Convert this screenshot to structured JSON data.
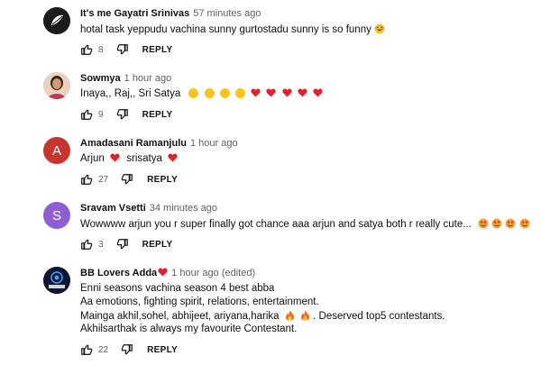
{
  "colors": {
    "heart": "#e5202e",
    "emoji_yellow": "#f7c51e",
    "emoji_face_red": "#f2a43a",
    "avatar_red": "#c6362f",
    "avatar_purple": "#8e5fd2",
    "secondary_text": "#606060"
  },
  "comments": [
    {
      "author": "It's me Gayatri Srinivas",
      "time": "57 minutes ago",
      "text": "hotal task yeppudu vachina sunny gurtostadu sunny is so funny",
      "emoji": "rofl-emoji",
      "likes": "8",
      "reply_label": "REPLY",
      "avatar_icon": "leaf-avatar"
    },
    {
      "author": "Sowmya",
      "time": "1 hour ago",
      "text": "Inaya,, Raj,, Sri Satya",
      "emoji": "clap-emoji x4, red-heart x5",
      "likes": "9",
      "reply_label": "REPLY",
      "avatar_icon": "photo-avatar"
    },
    {
      "author": "Amadasani Ramanjulu",
      "time": "1 hour ago",
      "text_a": "Arjun",
      "text_b": "srisatya",
      "likes": "27",
      "reply_label": "REPLY",
      "avatar_letter": "A"
    },
    {
      "author": "Sravam Vsetti",
      "time": "34 minutes ago",
      "text": "Wowwww arjun you r super finally got chance aaa arjun and satya both r really cute...",
      "emoji": "heart-eyes-emoji x4",
      "likes": "3",
      "reply_label": "REPLY",
      "avatar_letter": "S"
    },
    {
      "author": "BB Lovers Adda",
      "time": "1 hour ago (edited)",
      "line1": "Enni seasons vachina season 4 best abba",
      "line2": "Aa emotions, fighting spirit, relations, entertainment.",
      "line3a": "Mainga akhil,sohel, abhijeet, ariyana,harika",
      "line3b": ". Deserved top5 contestants.",
      "line4": "Akhilsarthak is always my favourite Contestant.",
      "likes": "22",
      "reply_label": "REPLY",
      "avatar_icon": "bb-logo-avatar"
    }
  ]
}
